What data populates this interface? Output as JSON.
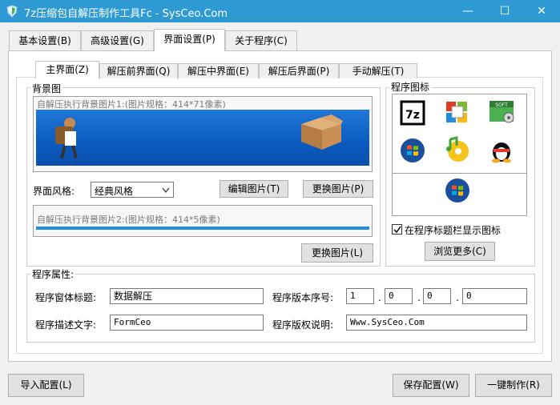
{
  "window": {
    "title": "7z压缩包自解压制作工具Fc - SysCeo.Com",
    "minimize": "—",
    "maximize": "☐",
    "close": "✕"
  },
  "main_tabs": [
    "基本设置(B)",
    "高级设置(G)",
    "界面设置(P)",
    "关于程序(C)"
  ],
  "sub_tabs": [
    "主界面(Z)",
    "解压前界面(Q)",
    "解压中界面(E)",
    "解压后界面(P)",
    "手动解压(T)"
  ],
  "background": {
    "legend": "背景图",
    "image1_caption": "自解压执行背景图片1:(图片规格：414*71像素)",
    "style_label": "界面风格:",
    "style_value": "经典风格",
    "edit_button": "编辑图片(T)",
    "replace_button1": "更换图片(P)",
    "image2_caption": "自解压执行背景图片2:(图片规格：414*5像素)",
    "replace_button2": "更换图片(L)"
  },
  "icons": {
    "legend": "程序图标",
    "show_in_titlebar_label": "在程序标题栏显示图标",
    "show_in_titlebar_checked": true,
    "browse_more_button": "浏览更多(C)",
    "items": [
      "7z-icon",
      "office-icon",
      "soft-icon",
      "windows-icon",
      "cd-music-icon",
      "qq-penguin-icon",
      "windows-icon"
    ]
  },
  "properties": {
    "legend": "程序属性:",
    "window_title_label": "程序窗体标题:",
    "window_title_value": "数据解压",
    "version_label": "程序版本序号:",
    "version_values": [
      "1",
      "0",
      "0",
      "0"
    ],
    "version_separator": ".",
    "description_label": "程序描述文字:",
    "description_value": "FormCeo",
    "copyright_label": "程序版权说明:",
    "copyright_value": "Www.SysCeo.Com"
  },
  "footer": {
    "import_button": "导入配置(L)",
    "save_button": "保存配置(W)",
    "build_button": "一键制作(R)"
  },
  "colors": {
    "titlebar": "#2d9ad3",
    "banner": "#0a5ac0",
    "progress": "#1d8fe0"
  }
}
